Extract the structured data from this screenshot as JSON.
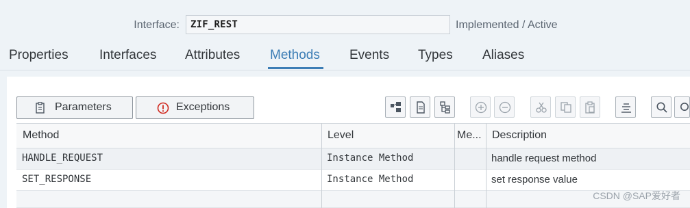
{
  "header": {
    "interface_label": "Interface:",
    "interface_value": "ZIF_REST",
    "status": "Implemented / Active"
  },
  "tabs": [
    {
      "label": "Properties"
    },
    {
      "label": "Interfaces"
    },
    {
      "label": "Attributes"
    },
    {
      "label": "Methods"
    },
    {
      "label": "Events"
    },
    {
      "label": "Types"
    },
    {
      "label": "Aliases"
    }
  ],
  "active_tab": "Methods",
  "toolbar": {
    "parameters_label": "Parameters",
    "exceptions_label": "Exceptions",
    "icons": [
      "tree-icon",
      "document-icon",
      "hierarchy-icon",
      "add-row-icon",
      "remove-row-icon",
      "cut-icon",
      "copy-icon",
      "paste-icon",
      "align-icon",
      "search-icon",
      "search-next-icon"
    ]
  },
  "table": {
    "columns": [
      "Method",
      "Level",
      "Me...",
      "Description"
    ],
    "rows": [
      {
        "method": "HANDLE_REQUEST",
        "level": "Instance Method",
        "me": "",
        "description": "handle request method"
      },
      {
        "method": "SET_RESPONSE",
        "level": "Instance Method",
        "me": "",
        "description": "set response value"
      }
    ]
  },
  "watermark": "CSDN @SAP爱好者",
  "colors": {
    "accent": "#3c7db5",
    "exception_red": "#d0271d"
  }
}
